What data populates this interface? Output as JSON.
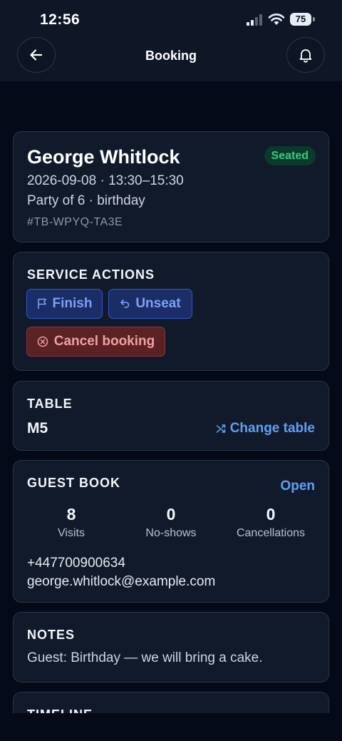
{
  "status_bar": {
    "time": "12:56",
    "battery": "75"
  },
  "nav": {
    "title": "Booking",
    "back_icon": "arrow-left-icon",
    "bell_icon": "bell-icon"
  },
  "booking": {
    "guest_name": "George Whitlock",
    "status": "Seated",
    "datetime": "2026-09-08 · 13:30–15:30",
    "party": "Party of 6 · birthday",
    "reference": "#TB-WPYQ-TA3E",
    "status_color": "#36c98a"
  },
  "service_actions": {
    "title": "SERVICE ACTIONS",
    "finish": "Finish",
    "unseat": "Unseat",
    "cancel": "Cancel booking"
  },
  "table": {
    "title": "TABLE",
    "value": "M5",
    "change": "Change table"
  },
  "guest_book": {
    "title": "GUEST BOOK",
    "open": "Open",
    "stats": [
      {
        "value": "8",
        "label": "Visits"
      },
      {
        "value": "0",
        "label": "No-shows"
      },
      {
        "value": "0",
        "label": "Cancellations"
      }
    ],
    "phone": "+447700900634",
    "email": "george.whitlock@example.com"
  },
  "notes": {
    "title": "NOTES",
    "text": "Guest: Birthday — we will bring a cake."
  },
  "timeline": {
    "title": "TIMELINE"
  }
}
